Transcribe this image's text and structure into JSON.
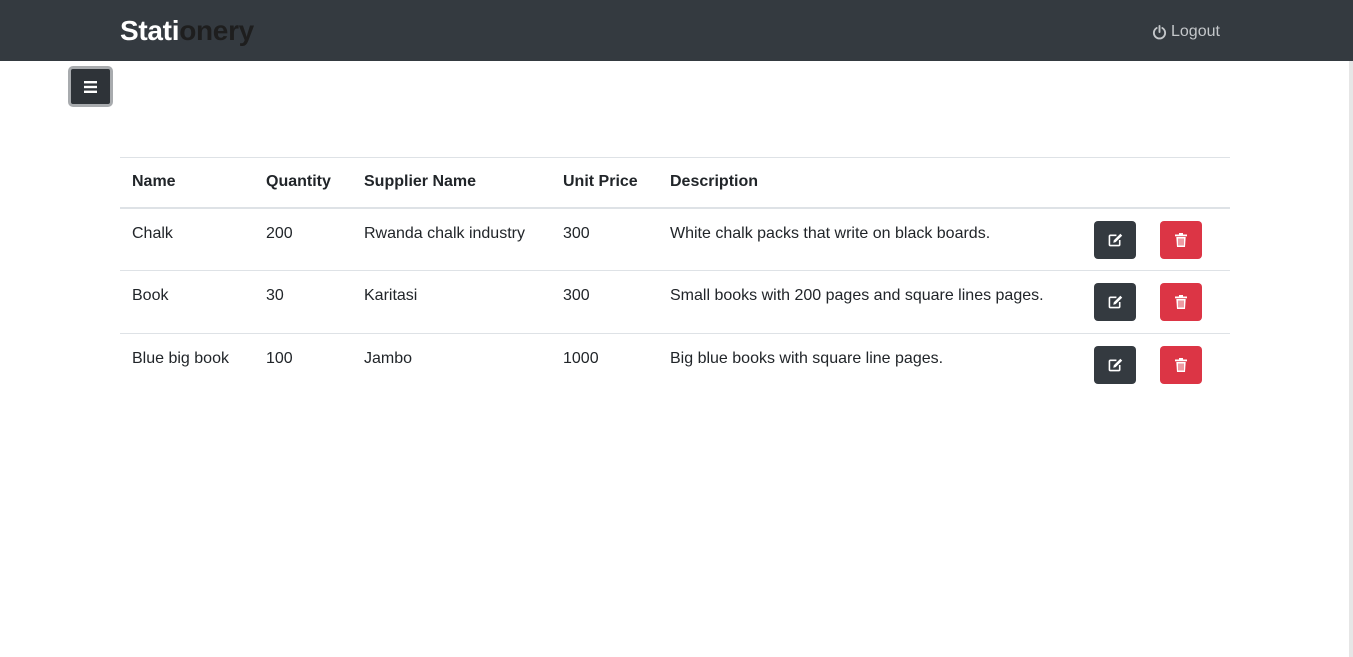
{
  "header": {
    "brand_part1": "Stati",
    "brand_part2": "onery",
    "logout_label": "Logout"
  },
  "icons": {
    "menu": "hamburger-icon",
    "logout": "power-icon",
    "edit": "edit-icon",
    "delete": "trash-icon"
  },
  "colors": {
    "navbar": "#343a40",
    "edit_button": "#343a40",
    "delete_button": "#dc3545"
  },
  "table": {
    "columns": [
      "Name",
      "Quantity",
      "Supplier Name",
      "Unit Price",
      "Description"
    ],
    "rows": [
      {
        "name": "Chalk",
        "quantity": "200",
        "supplier": "Rwanda chalk industry",
        "unit_price": "300",
        "description": "White chalk packs that write on black boards."
      },
      {
        "name": "Book",
        "quantity": "30",
        "supplier": "Karitasi",
        "unit_price": "300",
        "description": "Small books with 200 pages and square lines pages."
      },
      {
        "name": "Blue big book",
        "quantity": "100",
        "supplier": "Jambo",
        "unit_price": "1000",
        "description": "Big blue books with square line pages."
      }
    ]
  }
}
